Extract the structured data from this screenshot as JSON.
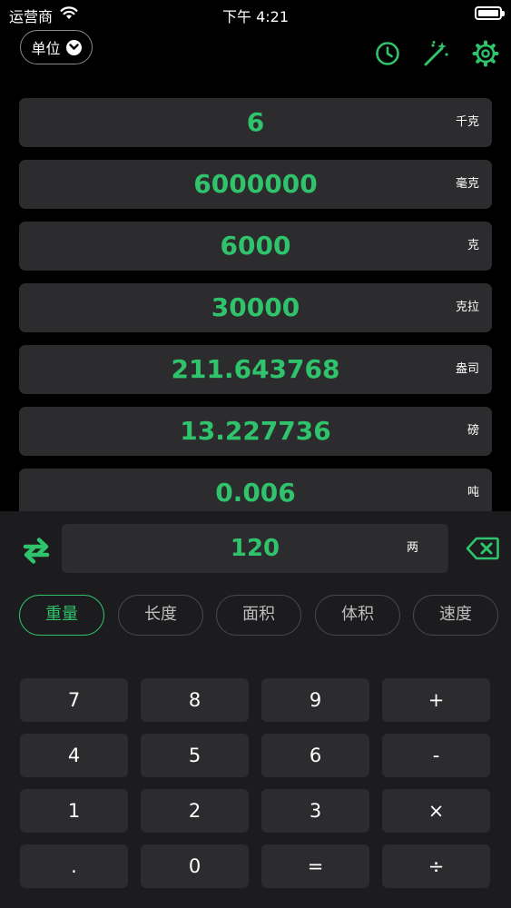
{
  "status_bar": {
    "carrier": "运营商",
    "time": "下午 4:21"
  },
  "header": {
    "unit_button": "单位",
    "icons": [
      "history-icon",
      "magic-wand-icon",
      "settings-icon"
    ]
  },
  "results": [
    {
      "value": "6",
      "unit": "千克"
    },
    {
      "value": "6000000",
      "unit": "毫克"
    },
    {
      "value": "6000",
      "unit": "克"
    },
    {
      "value": "30000",
      "unit": "克拉"
    },
    {
      "value": "211.643768",
      "unit": "盎司"
    },
    {
      "value": "13.227736",
      "unit": "磅"
    },
    {
      "value": "0.006",
      "unit": "吨"
    }
  ],
  "input": {
    "value": "120",
    "unit": "两"
  },
  "categories": [
    "重量",
    "长度",
    "面积",
    "体积",
    "速度"
  ],
  "active_category": "重量",
  "keypad": [
    [
      "7",
      "8",
      "9",
      "+"
    ],
    [
      "4",
      "5",
      "6",
      "-"
    ],
    [
      "1",
      "2",
      "3",
      "×"
    ],
    [
      ".",
      "0",
      "=",
      "÷"
    ]
  ],
  "colors": {
    "accent": "#2fc36b",
    "background": "#000000",
    "panel": "#1c1c1e",
    "row": "#2c2c2e"
  }
}
